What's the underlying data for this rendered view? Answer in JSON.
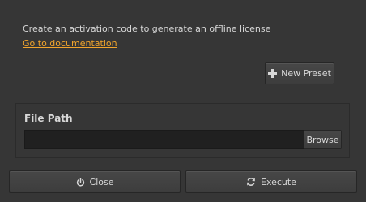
{
  "description": "Create an activation code to generate an offline license",
  "documentation_link": "Go to documentation",
  "new_preset": {
    "label": "New Preset",
    "icon": "plus-icon"
  },
  "file_path": {
    "title": "File Path",
    "value": "",
    "browse_label": "Browse"
  },
  "footer": {
    "close_label": "Close",
    "close_icon": "power-icon",
    "execute_label": "Execute",
    "execute_icon": "refresh-icon"
  },
  "colors": {
    "background": "#363636",
    "link": "#f2a52c",
    "input": "#202020",
    "text": "#d8d8d8"
  }
}
